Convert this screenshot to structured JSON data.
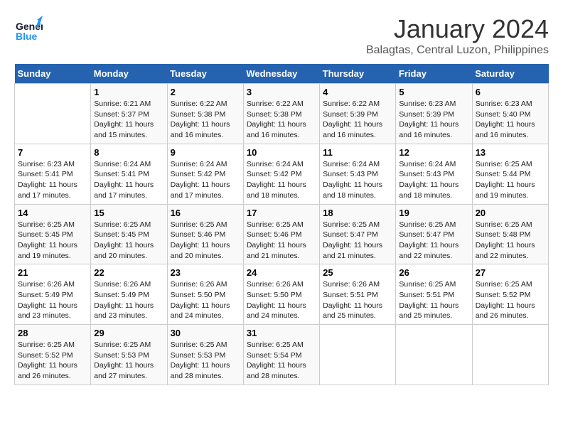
{
  "header": {
    "logo_line1": "General",
    "logo_line2": "Blue",
    "month_title": "January 2024",
    "location": "Balagtas, Central Luzon, Philippines"
  },
  "days_of_week": [
    "Sunday",
    "Monday",
    "Tuesday",
    "Wednesday",
    "Thursday",
    "Friday",
    "Saturday"
  ],
  "weeks": [
    [
      {
        "day": "",
        "info": ""
      },
      {
        "day": "1",
        "info": "Sunrise: 6:21 AM\nSunset: 5:37 PM\nDaylight: 11 hours\nand 15 minutes."
      },
      {
        "day": "2",
        "info": "Sunrise: 6:22 AM\nSunset: 5:38 PM\nDaylight: 11 hours\nand 16 minutes."
      },
      {
        "day": "3",
        "info": "Sunrise: 6:22 AM\nSunset: 5:38 PM\nDaylight: 11 hours\nand 16 minutes."
      },
      {
        "day": "4",
        "info": "Sunrise: 6:22 AM\nSunset: 5:39 PM\nDaylight: 11 hours\nand 16 minutes."
      },
      {
        "day": "5",
        "info": "Sunrise: 6:23 AM\nSunset: 5:39 PM\nDaylight: 11 hours\nand 16 minutes."
      },
      {
        "day": "6",
        "info": "Sunrise: 6:23 AM\nSunset: 5:40 PM\nDaylight: 11 hours\nand 16 minutes."
      }
    ],
    [
      {
        "day": "7",
        "info": "Sunrise: 6:23 AM\nSunset: 5:41 PM\nDaylight: 11 hours\nand 17 minutes."
      },
      {
        "day": "8",
        "info": "Sunrise: 6:24 AM\nSunset: 5:41 PM\nDaylight: 11 hours\nand 17 minutes."
      },
      {
        "day": "9",
        "info": "Sunrise: 6:24 AM\nSunset: 5:42 PM\nDaylight: 11 hours\nand 17 minutes."
      },
      {
        "day": "10",
        "info": "Sunrise: 6:24 AM\nSunset: 5:42 PM\nDaylight: 11 hours\nand 18 minutes."
      },
      {
        "day": "11",
        "info": "Sunrise: 6:24 AM\nSunset: 5:43 PM\nDaylight: 11 hours\nand 18 minutes."
      },
      {
        "day": "12",
        "info": "Sunrise: 6:24 AM\nSunset: 5:43 PM\nDaylight: 11 hours\nand 18 minutes."
      },
      {
        "day": "13",
        "info": "Sunrise: 6:25 AM\nSunset: 5:44 PM\nDaylight: 11 hours\nand 19 minutes."
      }
    ],
    [
      {
        "day": "14",
        "info": "Sunrise: 6:25 AM\nSunset: 5:45 PM\nDaylight: 11 hours\nand 19 minutes."
      },
      {
        "day": "15",
        "info": "Sunrise: 6:25 AM\nSunset: 5:45 PM\nDaylight: 11 hours\nand 20 minutes."
      },
      {
        "day": "16",
        "info": "Sunrise: 6:25 AM\nSunset: 5:46 PM\nDaylight: 11 hours\nand 20 minutes."
      },
      {
        "day": "17",
        "info": "Sunrise: 6:25 AM\nSunset: 5:46 PM\nDaylight: 11 hours\nand 21 minutes."
      },
      {
        "day": "18",
        "info": "Sunrise: 6:25 AM\nSunset: 5:47 PM\nDaylight: 11 hours\nand 21 minutes."
      },
      {
        "day": "19",
        "info": "Sunrise: 6:25 AM\nSunset: 5:47 PM\nDaylight: 11 hours\nand 22 minutes."
      },
      {
        "day": "20",
        "info": "Sunrise: 6:25 AM\nSunset: 5:48 PM\nDaylight: 11 hours\nand 22 minutes."
      }
    ],
    [
      {
        "day": "21",
        "info": "Sunrise: 6:26 AM\nSunset: 5:49 PM\nDaylight: 11 hours\nand 23 minutes."
      },
      {
        "day": "22",
        "info": "Sunrise: 6:26 AM\nSunset: 5:49 PM\nDaylight: 11 hours\nand 23 minutes."
      },
      {
        "day": "23",
        "info": "Sunrise: 6:26 AM\nSunset: 5:50 PM\nDaylight: 11 hours\nand 24 minutes."
      },
      {
        "day": "24",
        "info": "Sunrise: 6:26 AM\nSunset: 5:50 PM\nDaylight: 11 hours\nand 24 minutes."
      },
      {
        "day": "25",
        "info": "Sunrise: 6:26 AM\nSunset: 5:51 PM\nDaylight: 11 hours\nand 25 minutes."
      },
      {
        "day": "26",
        "info": "Sunrise: 6:25 AM\nSunset: 5:51 PM\nDaylight: 11 hours\nand 25 minutes."
      },
      {
        "day": "27",
        "info": "Sunrise: 6:25 AM\nSunset: 5:52 PM\nDaylight: 11 hours\nand 26 minutes."
      }
    ],
    [
      {
        "day": "28",
        "info": "Sunrise: 6:25 AM\nSunset: 5:52 PM\nDaylight: 11 hours\nand 26 minutes."
      },
      {
        "day": "29",
        "info": "Sunrise: 6:25 AM\nSunset: 5:53 PM\nDaylight: 11 hours\nand 27 minutes."
      },
      {
        "day": "30",
        "info": "Sunrise: 6:25 AM\nSunset: 5:53 PM\nDaylight: 11 hours\nand 28 minutes."
      },
      {
        "day": "31",
        "info": "Sunrise: 6:25 AM\nSunset: 5:54 PM\nDaylight: 11 hours\nand 28 minutes."
      },
      {
        "day": "",
        "info": ""
      },
      {
        "day": "",
        "info": ""
      },
      {
        "day": "",
        "info": ""
      }
    ]
  ]
}
